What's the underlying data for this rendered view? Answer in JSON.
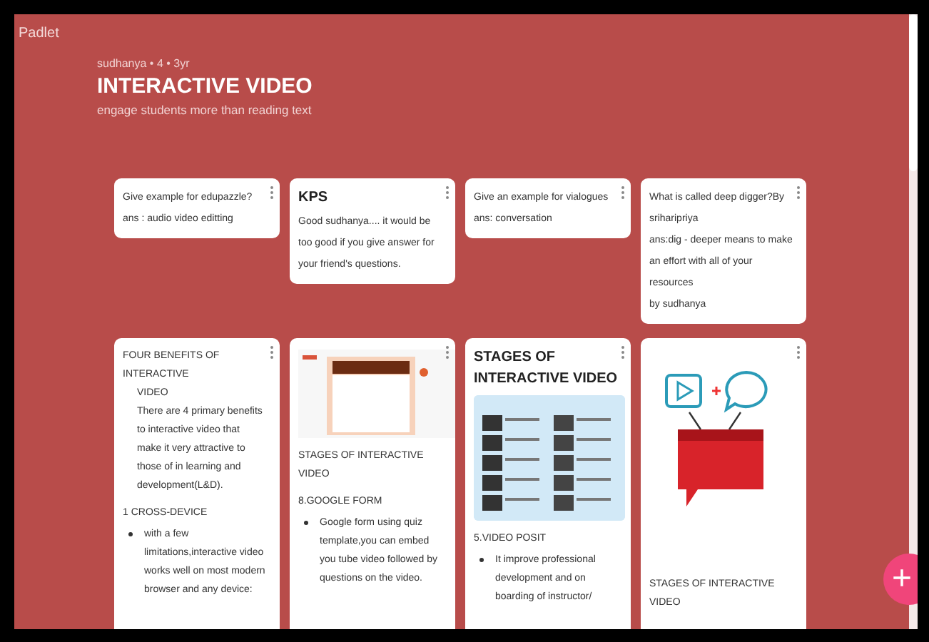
{
  "brand": "Padlet",
  "board": {
    "meta": "sudhanya • 4 • 3yr",
    "title": "INTERACTIVE VIDEO",
    "subtitle": "engage students more than reading text"
  },
  "rows": [
    [
      {
        "blocks": [
          {
            "kind": "text",
            "text": "Give example for edupazzle?"
          },
          {
            "kind": "text",
            "text": "ans : audio video editting"
          }
        ]
      },
      {
        "blocks": [
          {
            "kind": "heading",
            "text": "KPS"
          },
          {
            "kind": "text",
            "text": "Good sudhanya.... it would be too good if you give answer for your friend's questions."
          }
        ]
      },
      {
        "blocks": [
          {
            "kind": "text",
            "text": "Give an example for vialogues"
          },
          {
            "kind": "text",
            "text": "ans: conversation"
          }
        ]
      },
      {
        "blocks": [
          {
            "kind": "text",
            "text": "What is called deep digger?By sriharipriya"
          },
          {
            "kind": "text",
            "text": "ans:dig - deeper means to make an effort with all of your resources"
          },
          {
            "kind": "text",
            "text": "by sudhanya"
          }
        ]
      }
    ],
    [
      {
        "blocks": [
          {
            "kind": "text",
            "text": "FOUR BENEFITS OF INTERACTIVE"
          },
          {
            "kind": "indent",
            "text": "VIDEO"
          },
          {
            "kind": "indent",
            "text": "There are 4 primary benefits to interactive video that make it very attractive to those of in learning and development(L&D)."
          },
          {
            "kind": "section",
            "text": "1 CROSS-DEVICE"
          },
          {
            "kind": "bullet",
            "text": "with a few limitations,interactive video works well on most modern browser and any device:"
          }
        ]
      },
      {
        "blocks": [
          {
            "kind": "screenshot"
          },
          {
            "kind": "text",
            "text": "STAGES OF INTERACTIVE VIDEO"
          },
          {
            "kind": "section",
            "text": "8.GOOGLE FORM"
          },
          {
            "kind": "bullet",
            "text": "Google form using quiz template,you can embed you tube video followed by questions on the video."
          }
        ]
      },
      {
        "blocks": [
          {
            "kind": "heading",
            "text": "STAGES OF INTERACTIVE VIDEO"
          },
          {
            "kind": "video-grid"
          },
          {
            "kind": "text",
            "text": "5.VIDEO POSIT"
          },
          {
            "kind": "bullet",
            "text": "It improve professional development and on boarding of instructor/"
          }
        ]
      },
      {
        "blocks": [
          {
            "kind": "diagram"
          },
          {
            "kind": "text",
            "text": "STAGES OF INTERACTIVE VIDEO"
          }
        ]
      }
    ]
  ],
  "add_button": "+"
}
